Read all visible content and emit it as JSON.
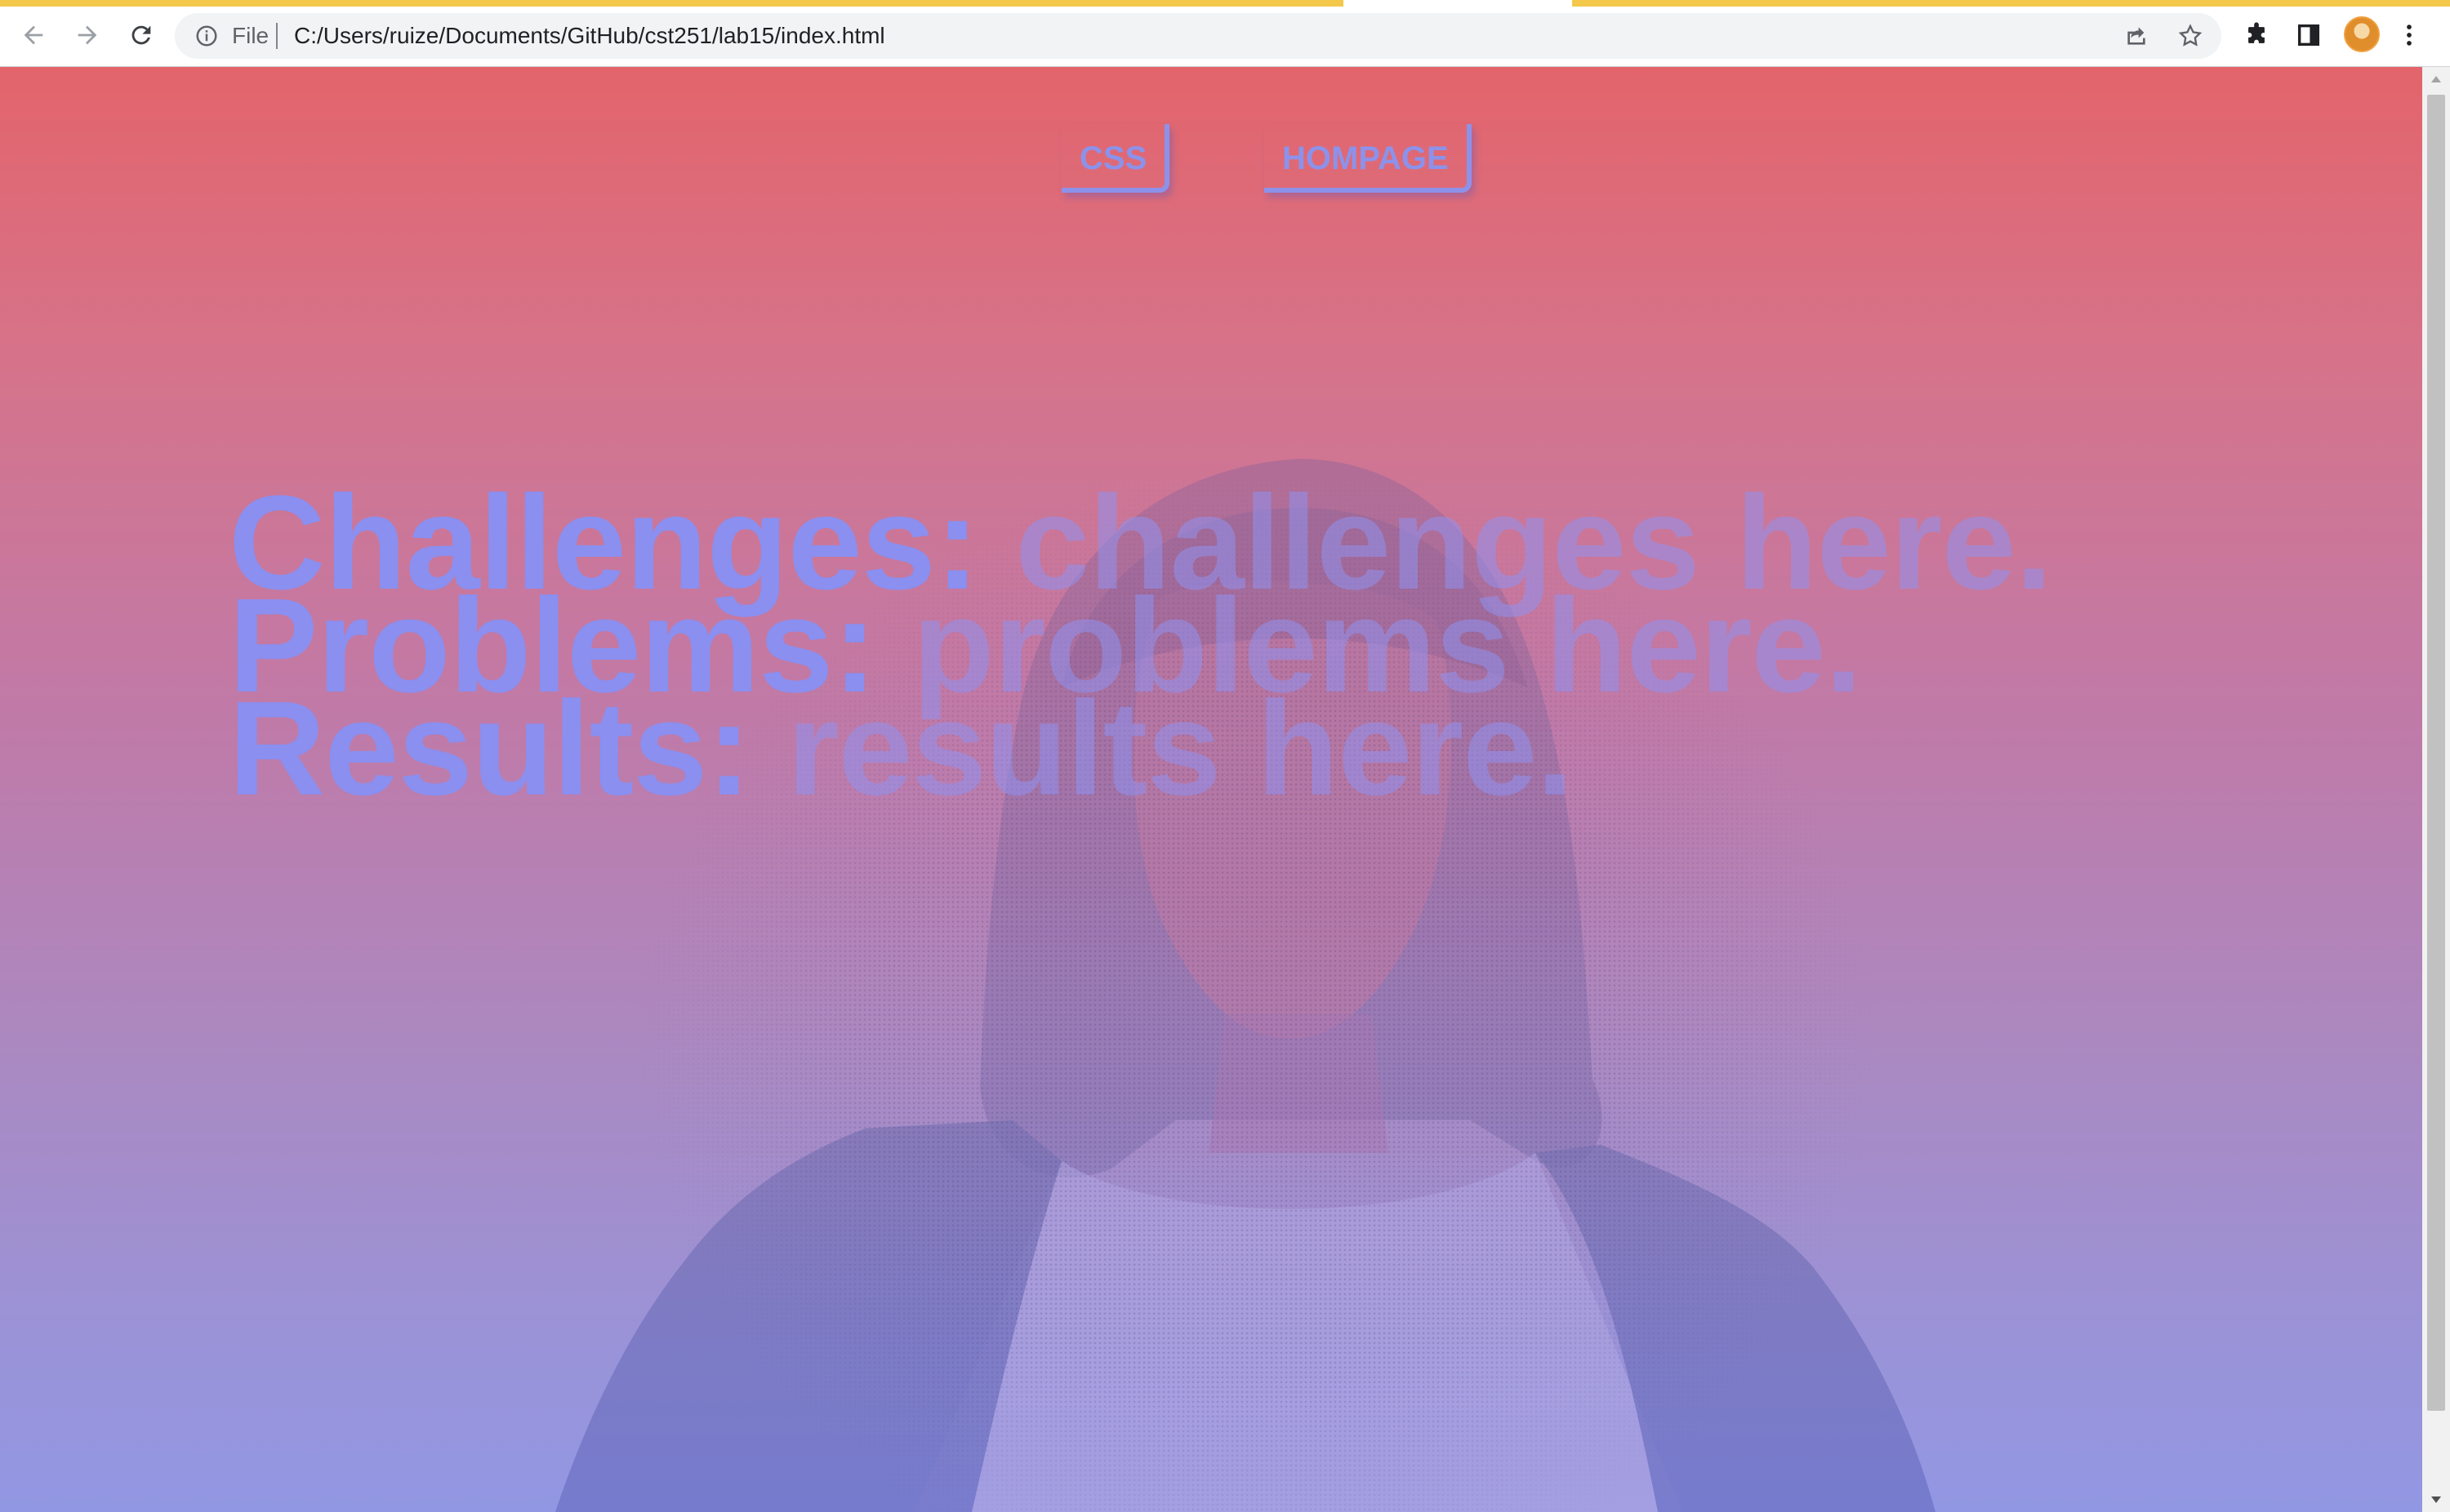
{
  "browser": {
    "url_scheme_label": "File",
    "url": "C:/Users/ruize/Documents/GitHub/cst251/lab15/index.html",
    "icons": [
      "back-arrow",
      "forward-arrow",
      "reload",
      "info",
      "share",
      "star",
      "extensions-puzzle",
      "side-panel",
      "profile-avatar",
      "kebab-menu"
    ]
  },
  "page": {
    "nav": {
      "css_label": "CSS",
      "home_label": "HOMPAGE"
    },
    "lines": [
      {
        "label": "Challenges:",
        "value": "challenges here."
      },
      {
        "label": "Problems:",
        "value": "problems here."
      },
      {
        "label": "Results:",
        "value": "results here."
      }
    ]
  },
  "colors": {
    "gradient_top": "#e3646b",
    "gradient_bottom": "#9297e3",
    "text_accent": "#8a8ff0"
  }
}
